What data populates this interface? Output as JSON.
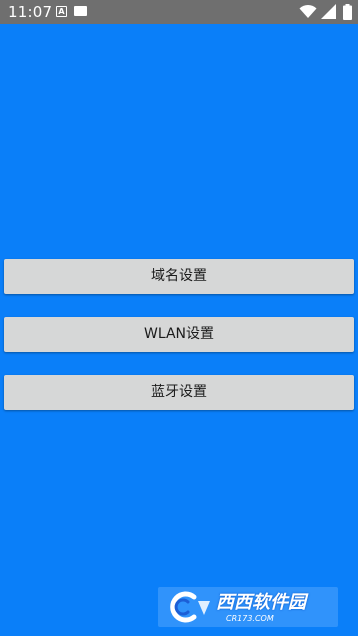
{
  "status_bar": {
    "time": "11:07",
    "notification_icon_letter": "A",
    "icons": [
      "a-notification-icon",
      "rectangle-notification-icon",
      "wifi-icon",
      "cellular-signal-icon",
      "battery-icon"
    ]
  },
  "buttons": [
    {
      "label": "域名设置"
    },
    {
      "label": "WLAN设置"
    },
    {
      "label": "蓝牙设置"
    }
  ],
  "watermark": {
    "text": "西西软件园",
    "url": "CR173.COM"
  },
  "colors": {
    "background": "#0a7ff9",
    "status_bar": "#6f6f6f",
    "button": "#d6d7d7"
  }
}
